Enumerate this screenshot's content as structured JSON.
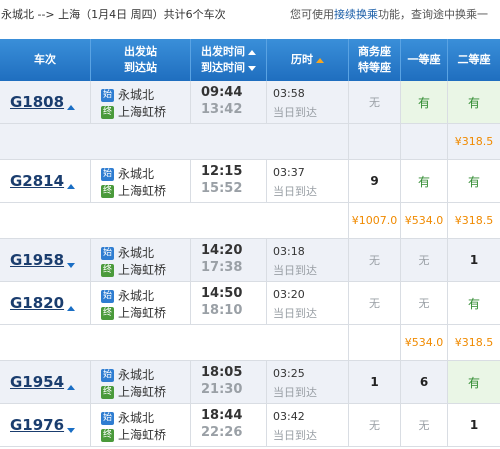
{
  "route": {
    "text": "永城北 --> 上海（1月4日  周四）共计6个车次",
    "hint_prefix": "您可使用",
    "hint_link": "接续换乘",
    "hint_suffix": "功能，查询途中换乘一"
  },
  "headers": {
    "train": "车次",
    "stations_1": "出发站",
    "stations_2": "到达站",
    "time_1": "出发时间",
    "time_2": "到达时间",
    "duration": "历时",
    "business_1": "商务座",
    "business_2": "特等座",
    "first": "一等座",
    "second": "二等座"
  },
  "trains": [
    {
      "no": "G1808",
      "from": "永城北",
      "to": "上海虹桥",
      "depart": "09:44",
      "arrive": "13:42",
      "duration": "03:58",
      "arrival_day": "当日到达",
      "business": "无",
      "first": "有",
      "second": "有",
      "price_business": "",
      "price_first": "",
      "price_second": "¥318.5"
    },
    {
      "no": "G2814",
      "from": "永城北",
      "to": "上海虹桥",
      "depart": "12:15",
      "arrive": "15:52",
      "duration": "03:37",
      "arrival_day": "当日到达",
      "business": "9",
      "first": "有",
      "second": "有",
      "price_business": "¥1007.0",
      "price_first": "¥534.0",
      "price_second": "¥318.5"
    },
    {
      "no": "G1958",
      "from": "永城北",
      "to": "上海虹桥",
      "depart": "14:20",
      "arrive": "17:38",
      "duration": "03:18",
      "arrival_day": "当日到达",
      "business": "无",
      "first": "无",
      "second": "1"
    },
    {
      "no": "G1820",
      "from": "永城北",
      "to": "上海虹桥",
      "depart": "14:50",
      "arrive": "18:10",
      "duration": "03:20",
      "arrival_day": "当日到达",
      "business": "无",
      "first": "无",
      "second": "有",
      "price_business": "",
      "price_first": "¥534.0",
      "price_second": "¥318.5"
    },
    {
      "no": "G1954",
      "from": "永城北",
      "to": "上海虹桥",
      "depart": "18:05",
      "arrive": "21:30",
      "duration": "03:25",
      "arrival_day": "当日到达",
      "business": "1",
      "first": "6",
      "second": "有"
    },
    {
      "no": "G1976",
      "from": "永城北",
      "to": "上海虹桥",
      "depart": "18:44",
      "arrive": "22:26",
      "duration": "03:42",
      "arrival_day": "当日到达",
      "business": "无",
      "first": "无",
      "second": "1"
    }
  ],
  "badges": {
    "start": "始",
    "end": "终"
  }
}
